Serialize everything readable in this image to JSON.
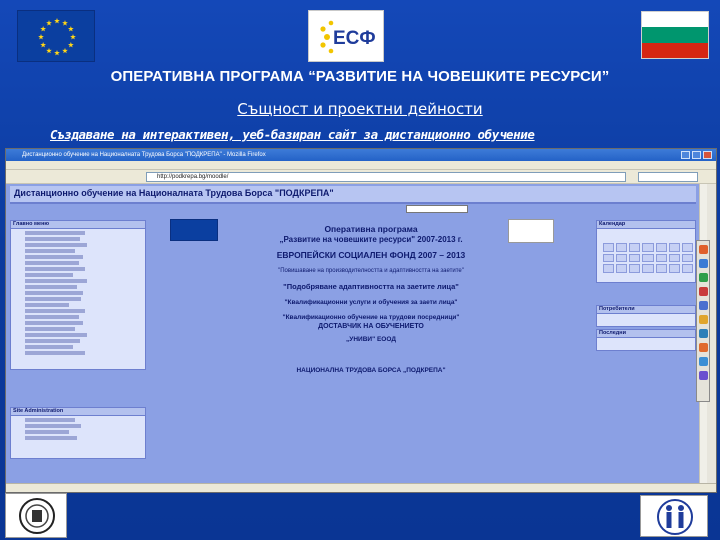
{
  "slide": {
    "title": "ОПЕРАТИВНА ПРОГРАМА “РАЗВИТИЕ НА ЧОВЕШКИТЕ РЕСУРСИ”",
    "subtitle": "Същност и проектни дейности",
    "description": "Създаване на интерактивен, уеб-базиран сайт за дистанционно обучение"
  },
  "logos": {
    "esf_text": "ЕСФ"
  },
  "browser": {
    "window_title": "Дистанционно обучение на Националната Трудова Борса \"ПОДКРЕПА\" - Mozilla Firefox",
    "url": "http://podkrepa.bg/moodle/"
  },
  "site": {
    "title": "Дистанционно обучение на Националната Трудова Борса \"ПОДКРЕПА\"",
    "blocks": {
      "main_menu": "Главно меню",
      "site_admin": "Site Administration",
      "calendar": "Календар",
      "right_mid": "Потребители",
      "right_low": "Последни"
    },
    "center_lines": [
      "Оперативна програма",
      "„Развитие на човешките ресурси\" 2007-2013 г.",
      "ЕВРОПЕЙСКИ СОЦИАЛЕН ФОНД 2007 – 2013",
      "\"Повишаване на производителността и адаптивността на заетите\"",
      "\"Подобряване адаптивността на заетите лица\"",
      "\"Квалификационни услуги и обучения за заети лица\"",
      "\"Квалификационно обучение на трудови посредници\"",
      "ДОСТАВЧИК НА ОБУЧЕНИЕТО",
      "„УНИВИ\" ЕООД",
      "НАЦИОНАЛНА ТРУДОВА БОРСА „ПОДКРЕПА\""
    ]
  },
  "colors": {
    "slide_bg": "#0b3b9e",
    "site_bg": "#8ba0e4",
    "flag_white": "#ffffff",
    "flag_green": "#00966e",
    "flag_red": "#d62612"
  }
}
